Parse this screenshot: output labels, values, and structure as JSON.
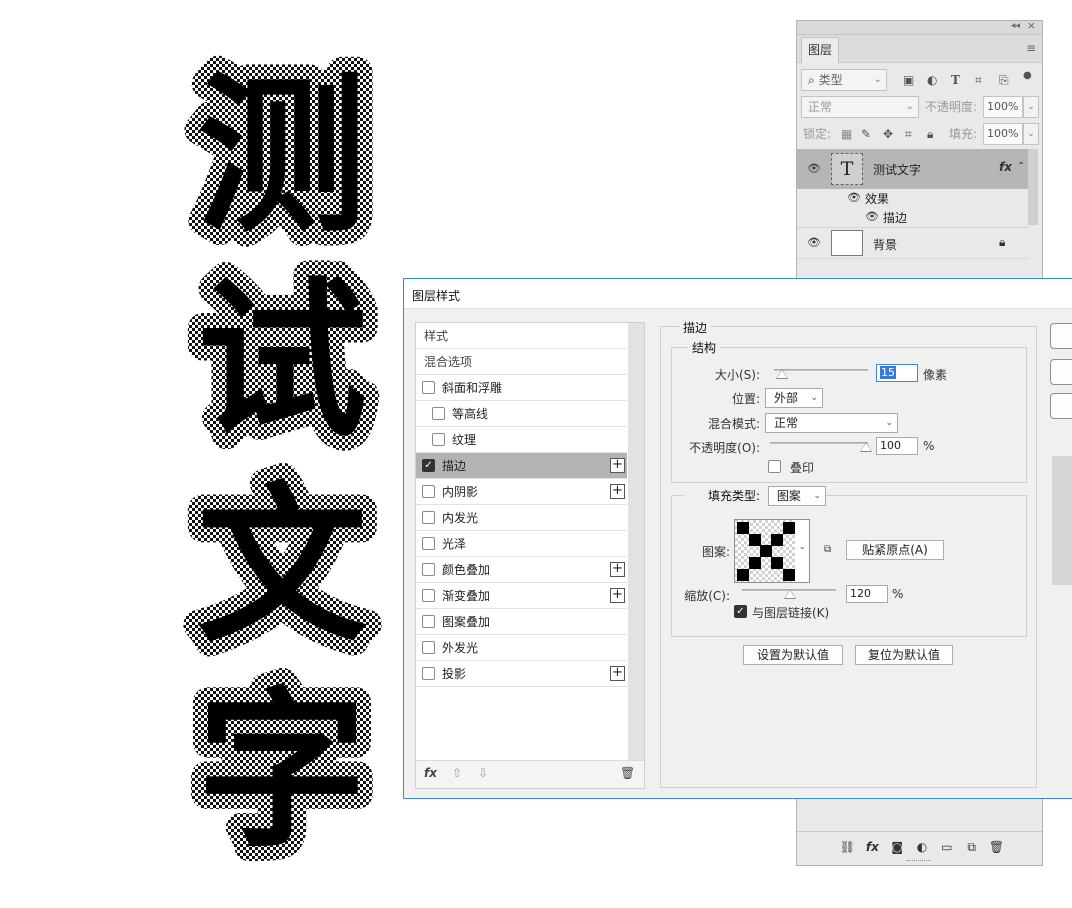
{
  "canvas": {
    "characters": [
      "测",
      "试",
      "文",
      "字"
    ]
  },
  "layers_panel": {
    "tab_label": "图层",
    "filter": {
      "search_icon": "search-icon",
      "kind_label": "类型"
    },
    "blend_mode": "正常",
    "opacity_label": "不透明度:",
    "opacity_value": "100%",
    "lock_label": "锁定:",
    "fill_label": "填充:",
    "fill_value": "100%",
    "layers": [
      {
        "name": "测试文字",
        "thumb_glyph": "T",
        "fx": "fx",
        "selected": true
      },
      {
        "name": "背景",
        "locked": true
      }
    ],
    "effects_label": "效果",
    "effect_stroke_label": "描边"
  },
  "dialog": {
    "title": "图层样式",
    "style_list": {
      "header_styles": "样式",
      "header_blend": "混合选项",
      "items": [
        {
          "label": "斜面和浮雕",
          "checked": false,
          "plus": false,
          "indent": false
        },
        {
          "label": "等高线",
          "checked": false,
          "plus": false,
          "indent": true
        },
        {
          "label": "纹理",
          "checked": false,
          "plus": false,
          "indent": true
        },
        {
          "label": "描边",
          "checked": true,
          "plus": true,
          "indent": false,
          "active": true
        },
        {
          "label": "内阴影",
          "checked": false,
          "plus": true,
          "indent": false
        },
        {
          "label": "内发光",
          "checked": false,
          "plus": false,
          "indent": false
        },
        {
          "label": "光泽",
          "checked": false,
          "plus": false,
          "indent": false
        },
        {
          "label": "颜色叠加",
          "checked": false,
          "plus": true,
          "indent": false
        },
        {
          "label": "渐变叠加",
          "checked": false,
          "plus": true,
          "indent": false
        },
        {
          "label": "图案叠加",
          "checked": false,
          "plus": false,
          "indent": false
        },
        {
          "label": "外发光",
          "checked": false,
          "plus": false,
          "indent": false
        },
        {
          "label": "投影",
          "checked": false,
          "plus": true,
          "indent": false
        }
      ],
      "footer_fx": "fx"
    },
    "stroke": {
      "section_title": "描边",
      "structure_title": "结构",
      "size_label": "大小(S):",
      "size_value": "15",
      "size_unit": "像素",
      "position_label": "位置:",
      "position_value": "外部",
      "blend_label": "混合模式:",
      "blend_value": "正常",
      "opacity_label": "不透明度(O):",
      "opacity_value": "100",
      "opacity_unit": "%",
      "overprint_label": "叠印",
      "fill_type_label": "填充类型:",
      "fill_type_value": "图案",
      "pattern_label": "图案:",
      "snap_button": "贴紧原点(A)",
      "scale_label": "缩放(C):",
      "scale_value": "120",
      "scale_unit": "%",
      "link_label": "与图层链接(K)",
      "set_default_button": "设置为默认值",
      "reset_default_button": "复位为默认值"
    }
  }
}
